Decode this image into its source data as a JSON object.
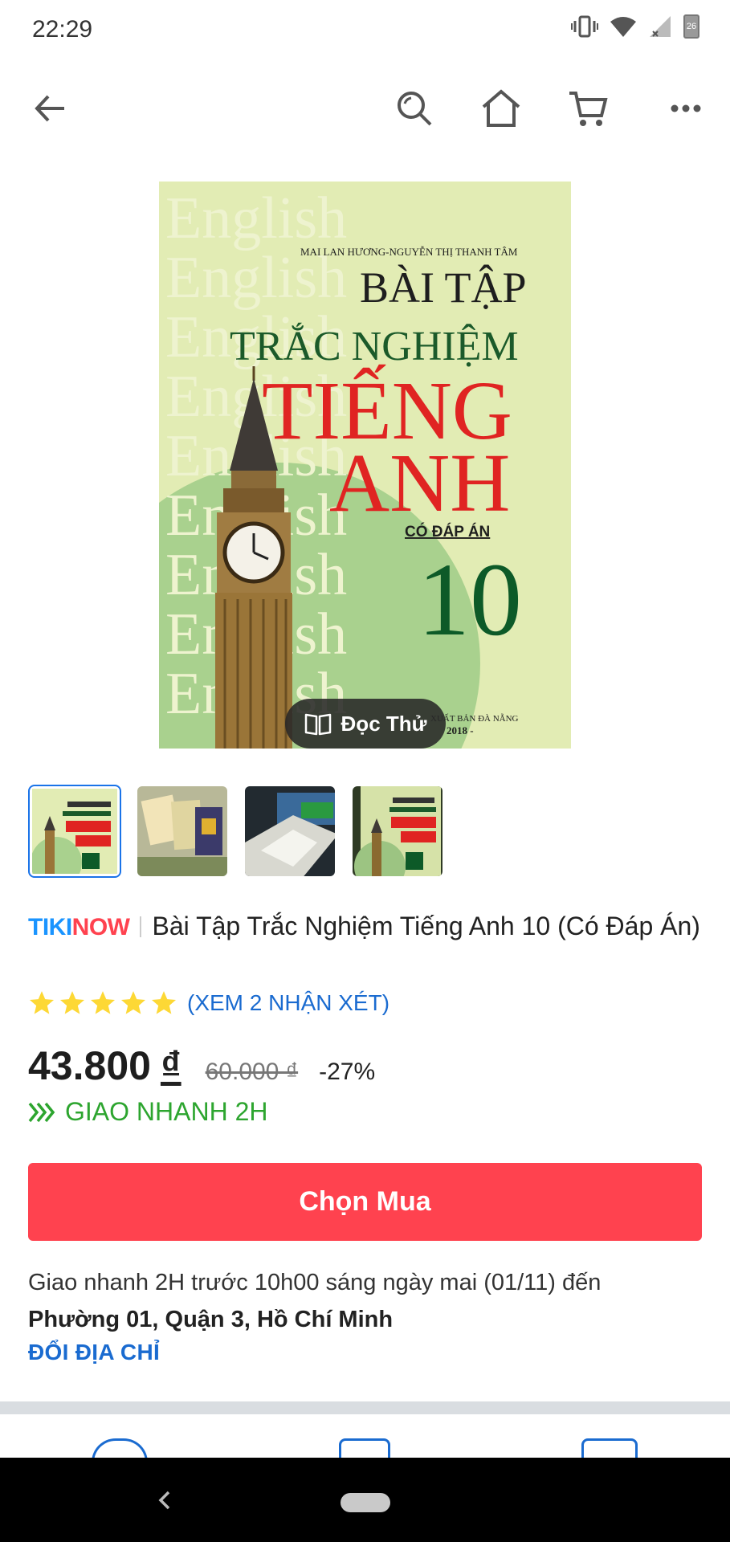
{
  "status_bar": {
    "time": "22:29",
    "battery": "26"
  },
  "top_nav": {
    "icons": [
      "back-arrow-icon",
      "search-icon",
      "home-icon",
      "cart-icon",
      "more-icon"
    ]
  },
  "cover": {
    "authors": "MAI LAN HƯƠNG-NGUYỄN THỊ THANH TÂM",
    "line1": "BÀI TẬP",
    "line2": "TRẮC NGHIỆM",
    "line3": "TIẾNG",
    "line4": "ANH",
    "subtitle": "CÓ ĐÁP ÁN",
    "grade": "10",
    "publisher": "XUẤT BẢN ĐÀ NẴNG",
    "year": "2018 -",
    "watermark": "English"
  },
  "read_button": {
    "label": "Đọc Thử"
  },
  "thumbnails": {
    "count": 4,
    "active_index": 0
  },
  "product": {
    "badge_tiki": "TIKI",
    "badge_now": "NOW",
    "title": "Bài Tập Trắc Nghiệm Tiếng Anh 10 (Có Đáp Án)",
    "rating": 5,
    "review_link": "(XEM 2 NHẬN XÉT)"
  },
  "price": {
    "current": "43.800",
    "currency": "₫",
    "old": "60.000 ₫",
    "discount": "-27%"
  },
  "fast_delivery": {
    "label": "GIAO NHANH 2H"
  },
  "buy_button": {
    "label": "Chọn Mua"
  },
  "delivery": {
    "text": "Giao nhanh 2H trước 10h00 sáng ngày mai (01/11) đến",
    "address": "Phường 01, Quận 3, Hồ Chí Minh",
    "change_link": "ĐỔI ĐỊA CHỈ"
  },
  "colors": {
    "accent_red": "#ff424f",
    "link_blue": "#1a6bd0",
    "green": "#2da52f"
  }
}
